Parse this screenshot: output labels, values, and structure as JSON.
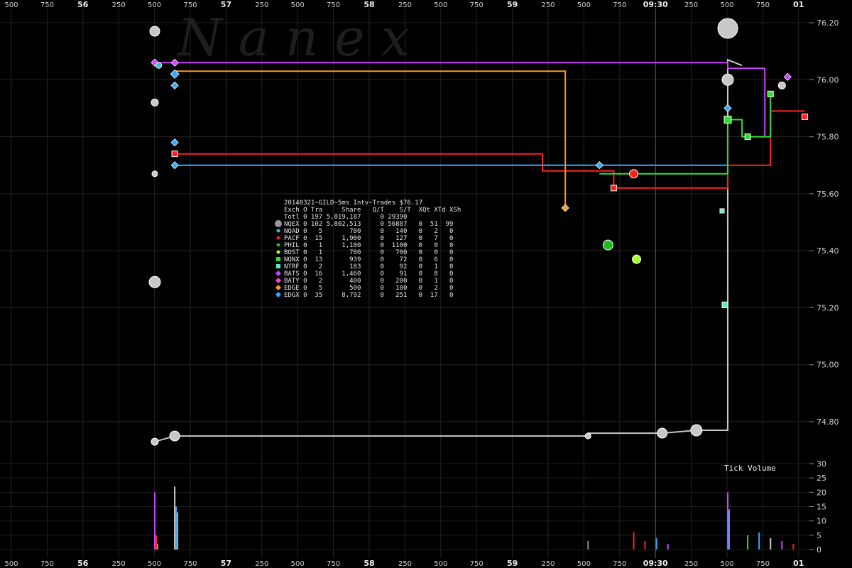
{
  "watermark": "N a n e x",
  "chart_data": [
    {
      "type": "line",
      "title": "20140321~GILD~5ms Intv~Trades $76.17",
      "x_tick_labels": [
        "500",
        "750",
        "56",
        "250",
        "500",
        "750",
        "57",
        "250",
        "500",
        "750",
        "58",
        "250",
        "500",
        "750",
        "59",
        "250",
        "500",
        "750",
        "09:30",
        "250",
        "500",
        "750",
        "01"
      ],
      "major_x_labels": [
        "56",
        "57",
        "58",
        "59",
        "09:30",
        "01"
      ],
      "y_ticks": [
        "76.20",
        "76.00",
        "75.80",
        "75.60",
        "75.40",
        "75.20",
        "75.00",
        "74.80"
      ],
      "ylim": [
        74.65,
        76.25
      ],
      "grid": true,
      "colors": {
        "NQEX": "#c8c8c8",
        "PACF": "#ff2020",
        "NQNX": "#33dd33",
        "BATS": "#cc44ff",
        "EDGE": "#ff9922",
        "EDGX": "#33aaff",
        "NQAD": "#22cccc",
        "BOST": "#aaff33",
        "PHIL": "#22bb22",
        "NTRF": "#55eebb",
        "BATY": "#ff44cc"
      },
      "series": [
        {
          "name": "NQEX",
          "steps": [
            [
              0,
              74.73
            ],
            [
              3.5,
              74.75
            ],
            [
              76,
              74.75
            ],
            [
              76,
              74.76
            ],
            [
              89,
              74.76
            ],
            [
              95,
              74.77
            ],
            [
              100.5,
              74.77
            ],
            [
              100.5,
              76.07
            ],
            [
              103,
              76.05
            ]
          ]
        },
        {
          "name": "PACF",
          "steps": [
            [
              3.5,
              75.74
            ],
            [
              68,
              75.74
            ],
            [
              68,
              75.68
            ],
            [
              80.5,
              75.68
            ],
            [
              80.5,
              75.62
            ],
            [
              100.5,
              75.62
            ],
            [
              100.5,
              75.7
            ],
            [
              108,
              75.7
            ],
            [
              108,
              75.89
            ],
            [
              114,
              75.89
            ]
          ]
        },
        {
          "name": "BATS",
          "steps": [
            [
              0,
              76.06
            ],
            [
              100.5,
              76.06
            ],
            [
              100.5,
              76.04
            ],
            [
              107,
              76.04
            ],
            [
              107,
              75.8
            ]
          ]
        },
        {
          "name": "EDGE",
          "steps": [
            [
              3.5,
              76.03
            ],
            [
              72,
              76.03
            ],
            [
              72,
              75.55
            ]
          ]
        },
        {
          "name": "EDGX",
          "steps": [
            [
              3.5,
              75.7
            ],
            [
              85,
              75.7
            ],
            [
              100.5,
              75.7
            ],
            [
              100.5,
              75.8
            ]
          ]
        },
        {
          "name": "NQNX",
          "steps": [
            [
              78,
              75.67
            ],
            [
              100.5,
              75.67
            ],
            [
              100.5,
              75.86
            ],
            [
              103,
              75.86
            ],
            [
              103,
              75.8
            ],
            [
              108,
              75.8
            ],
            [
              108,
              75.95
            ]
          ]
        }
      ],
      "markers": [
        {
          "name": "NQEX",
          "x": 0,
          "y": 76.17,
          "shape": "circle",
          "r": 7
        },
        {
          "name": "NQEX",
          "x": 0,
          "y": 75.92,
          "shape": "circle",
          "r": 5
        },
        {
          "name": "NQEX",
          "x": 0,
          "y": 75.67,
          "shape": "circle",
          "r": 4
        },
        {
          "name": "NQEX",
          "x": 0,
          "y": 75.29,
          "shape": "circle",
          "r": 8
        },
        {
          "name": "NQEX",
          "x": 0,
          "y": 74.73,
          "shape": "circle",
          "r": 5
        },
        {
          "name": "NQEX",
          "x": 3.5,
          "y": 74.75,
          "shape": "circle",
          "r": 7
        },
        {
          "name": "NQEX",
          "x": 76,
          "y": 74.75,
          "shape": "circle",
          "r": 4
        },
        {
          "name": "NQEX",
          "x": 89,
          "y": 74.76,
          "shape": "circle",
          "r": 7
        },
        {
          "name": "NQEX",
          "x": 95,
          "y": 74.77,
          "shape": "circle",
          "r": 8
        },
        {
          "name": "NQEX",
          "x": 100.5,
          "y": 76.18,
          "shape": "circle",
          "r": 14
        },
        {
          "name": "NQEX",
          "x": 100.5,
          "y": 76.0,
          "shape": "circle",
          "r": 8
        },
        {
          "name": "NQEX",
          "x": 110,
          "y": 75.98,
          "shape": "circle",
          "r": 5
        },
        {
          "name": "PACF",
          "x": 3.5,
          "y": 75.74,
          "shape": "square",
          "r": 4
        },
        {
          "name": "PACF",
          "x": 80.5,
          "y": 75.62,
          "shape": "square",
          "r": 4
        },
        {
          "name": "PACF",
          "x": 114,
          "y": 75.87,
          "shape": "square",
          "r": 4
        },
        {
          "name": "PACF",
          "x": 84,
          "y": 75.67,
          "shape": "circle",
          "r": 6
        },
        {
          "name": "BATS",
          "x": 0,
          "y": 76.06,
          "shape": "diamond",
          "r": 5
        },
        {
          "name": "BATS",
          "x": 3.5,
          "y": 76.06,
          "shape": "diamond",
          "r": 5
        },
        {
          "name": "BATS",
          "x": 111,
          "y": 76.01,
          "shape": "diamond",
          "r": 5
        },
        {
          "name": "EDGE",
          "x": 72,
          "y": 75.55,
          "shape": "diamond",
          "r": 5
        },
        {
          "name": "EDGX",
          "x": 3.5,
          "y": 76.02,
          "shape": "diamond",
          "r": 6
        },
        {
          "name": "EDGX",
          "x": 3.5,
          "y": 75.98,
          "shape": "diamond",
          "r": 5
        },
        {
          "name": "EDGX",
          "x": 3.5,
          "y": 75.78,
          "shape": "diamond",
          "r": 5
        },
        {
          "name": "EDGX",
          "x": 3.5,
          "y": 75.7,
          "shape": "diamond",
          "r": 5
        },
        {
          "name": "EDGX",
          "x": 78,
          "y": 75.7,
          "shape": "diamond",
          "r": 5
        },
        {
          "name": "EDGX",
          "x": 100.5,
          "y": 75.9,
          "shape": "diamond",
          "r": 5
        },
        {
          "name": "NQNX",
          "x": 100.5,
          "y": 75.86,
          "shape": "square",
          "r": 5
        },
        {
          "name": "NQNX",
          "x": 108,
          "y": 75.95,
          "shape": "square",
          "r": 4
        },
        {
          "name": "NQNX",
          "x": 104,
          "y": 75.8,
          "shape": "square",
          "r": 4
        },
        {
          "name": "NQAD",
          "x": 0.7,
          "y": 76.05,
          "shape": "circle",
          "r": 4
        },
        {
          "name": "PHIL",
          "x": 79.5,
          "y": 75.42,
          "shape": "circle",
          "r": 7
        },
        {
          "name": "BOST",
          "x": 84.5,
          "y": 75.37,
          "shape": "circle",
          "r": 6
        },
        {
          "name": "NTRF",
          "x": 100,
          "y": 75.21,
          "shape": "square",
          "r": 4
        },
        {
          "name": "NTRF",
          "x": 99.5,
          "y": 75.54,
          "shape": "square",
          "r": 3
        }
      ],
      "legend_header": "Exch O Tra     Share   Q/T    S/T  XQt XTd XSh",
      "legend": [
        {
          "name": "Totl",
          "text": "Totl 0 197 5,819,187     0 29390"
        },
        {
          "name": "NQEX",
          "text": "NQEX 0 102 5,802,513     0 56887   0  51  99",
          "marker": "big-circle"
        },
        {
          "name": "NQAD",
          "text": "NQAD 0   5       700     0   140   0   2   0",
          "marker": "dot"
        },
        {
          "name": "PACF",
          "text": "PACF 0  15     1,900     0   127   0   7   0",
          "marker": "dot"
        },
        {
          "name": "PHIL",
          "text": "PHIL 0   1     1,100     0  1100   0   0   0",
          "marker": "dot"
        },
        {
          "name": "BOST",
          "text": "BOST 0   1       700     0   700   0   0   0",
          "marker": "dot"
        },
        {
          "name": "NQNX",
          "text": "NQNX 0  13       939     0    72   0   6   0",
          "marker": "square"
        },
        {
          "name": "NTRF",
          "text": "NTRF 0   2       183     0    92   0   1   0",
          "marker": "square"
        },
        {
          "name": "BATS",
          "text": "BATS 0  16     1,460     0    91   0   8   0",
          "marker": "diamond"
        },
        {
          "name": "BATY",
          "text": "BATY 0   2       400     0   200   0   1   0",
          "marker": "diamond"
        },
        {
          "name": "EDGE",
          "text": "EDGE 0   5       500     0   100   0   2   0",
          "marker": "diamond"
        },
        {
          "name": "EDGX",
          "text": "EDGX 0  35     8,792     0   251   0  17   0",
          "marker": "diamond"
        }
      ]
    },
    {
      "type": "bar",
      "title": "Tick Volume",
      "y_ticks": [
        "30",
        "25",
        "20",
        "15",
        "10",
        "5",
        "0"
      ],
      "ylim": [
        0,
        30
      ],
      "bars": [
        {
          "x": 0,
          "values": [
            20,
            5,
            2
          ],
          "colors": [
            "#cc44ff",
            "#ff2020",
            "#33dd33"
          ]
        },
        {
          "x": 3.5,
          "values": [
            22,
            15,
            13
          ],
          "colors": [
            "#cccccc",
            "#33aaff",
            "#ff9922"
          ]
        },
        {
          "x": 76,
          "values": [
            3
          ],
          "colors": [
            "#888888"
          ]
        },
        {
          "x": 84,
          "values": [
            6
          ],
          "colors": [
            "#ff2020"
          ]
        },
        {
          "x": 86,
          "values": [
            3
          ],
          "colors": [
            "#ff2020"
          ]
        },
        {
          "x": 88,
          "values": [
            4
          ],
          "colors": [
            "#33aaff"
          ]
        },
        {
          "x": 90,
          "values": [
            2
          ],
          "colors": [
            "#cc44ff"
          ]
        },
        {
          "x": 100.5,
          "values": [
            20,
            14
          ],
          "colors": [
            "#cc44ff",
            "#33aaff"
          ]
        },
        {
          "x": 104,
          "values": [
            5
          ],
          "colors": [
            "#33dd33"
          ]
        },
        {
          "x": 106,
          "values": [
            6
          ],
          "colors": [
            "#33aaff"
          ]
        },
        {
          "x": 108,
          "values": [
            4
          ],
          "colors": [
            "#cccccc"
          ]
        },
        {
          "x": 110,
          "values": [
            3
          ],
          "colors": [
            "#cc44ff"
          ]
        },
        {
          "x": 112,
          "values": [
            2
          ],
          "colors": [
            "#ff2020"
          ]
        }
      ]
    }
  ]
}
